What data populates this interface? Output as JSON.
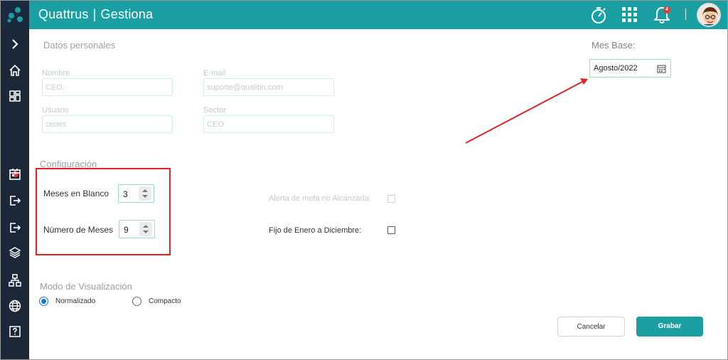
{
  "header": {
    "brand_name": "Quattrus",
    "brand_separator": "|",
    "brand_product": "Gestiona",
    "notifications_count": "4",
    "icons": [
      "stopwatch-icon",
      "apps-grid-icon",
      "bell-icon"
    ]
  },
  "sidebar": {
    "items": [
      "chevron-right-icon",
      "home-icon",
      "dashboard-icon",
      "calendar-icon",
      "logout-icon",
      "logout-icon",
      "layers-icon",
      "hierarchy-icon",
      "globe-icon",
      "help-icon"
    ],
    "badge_count": "5"
  },
  "personal": {
    "title": "Datos personales",
    "nombre_label": "Nombre",
    "nombre_value": "CEO,",
    "email_label": "E-mail",
    "email_value": "suporte@qualitin.com",
    "usuario_label": "Usuario",
    "usuario_value": "ceoes",
    "sector_label": "Sector",
    "sector_value": "CEO"
  },
  "config": {
    "title": "Configuración",
    "meses_blanco_label": "Meses en Blanco",
    "meses_blanco_value": "3",
    "numero_meses_label": "Número de Meses",
    "numero_meses_value": "9",
    "alerta_label": "Alerta de meta no Alcanzada:",
    "fijo_label": "Fijo de Enero a Diciembre:"
  },
  "mes_base": {
    "label": "Mes Base:",
    "value": "Agosto/2022"
  },
  "visual": {
    "title": "Modo de Visualización",
    "normalizado": "Normalizado",
    "compacto": "Compacto",
    "selected": "Normalizado"
  },
  "actions": {
    "cancel": "Cancelar",
    "save": "Grabar"
  },
  "colors": {
    "header": "#1a9fa3",
    "sidebar": "#1c2737",
    "annotation": "#e02424"
  }
}
